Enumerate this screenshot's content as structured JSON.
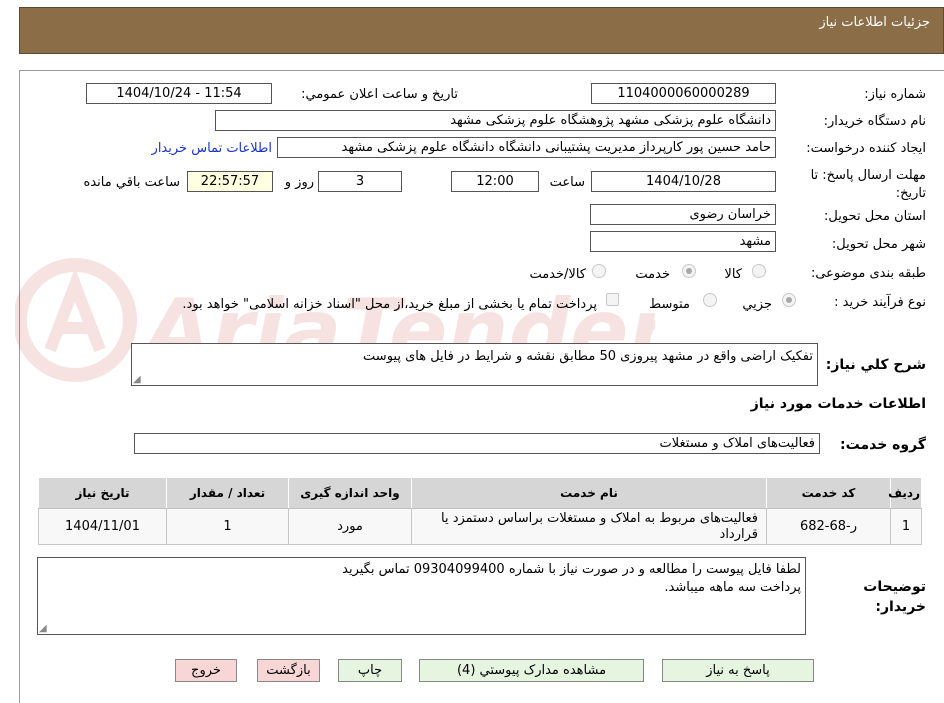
{
  "header": {
    "title": "جزئيات اطلاعات نياز"
  },
  "fields": {
    "need_number_label": "شماره نياز:",
    "need_number_value": "1104000060000289",
    "announce_label": "تاريخ و ساعت اعلان عمومي:",
    "announce_value": "1404/10/24 - 11:54",
    "buyer_org_label": "نام دستگاه خريدار:",
    "buyer_org_value": "دانشگاه علوم پزشکی مشهد   پژوهشگاه علوم پزشکی مشهد",
    "requester_label": "ايجاد کننده درخواست:",
    "requester_value": "حامد حسین پور کارپرداز مدیریت پشتیبانی دانشگاه دانشگاه علوم پزشکی مشهد",
    "contact_link": "اطلاعات تماس خريدار",
    "deadline_label": "مهلت ارسال پاسخ: تا تاريخ:",
    "deadline_date": "1404/10/28",
    "time_label": "ساعت",
    "deadline_time": "12:00",
    "days_value": "3",
    "days_label": "روز و",
    "remaining_time": "22:57:57",
    "remaining_label": "ساعت باقي مانده",
    "province_label": "استان محل تحويل:",
    "province_value": "خراسان رضوی",
    "city_label": "شهر محل تحويل:",
    "city_value": "مشهد"
  },
  "category": {
    "label": "طبقه بندی موضوعی:",
    "options": [
      "کالا",
      "خدمت",
      "کالا/خدمت"
    ],
    "selected": "خدمت"
  },
  "process": {
    "label": "نوع فرآيند خريد :",
    "options": [
      "جزيي",
      "متوسط"
    ],
    "selected": "جزيي",
    "note": "پرداخت تمام یا بخشی از مبلغ خرید،از محل \"اسناد خزانه اسلامی\" خواهد بود."
  },
  "description": {
    "label": "شرح کلي نياز:",
    "value": "تفکیک اراضی واقع در مشهد پیروزی 50 مطابق نقشه و شرایط در فایل های پیوست"
  },
  "services": {
    "section_title": "اطلاعات خدمات مورد نياز",
    "group_label": "گروه خدمت:",
    "group_value": "فعالیت‌های  املاک و مستغلات",
    "columns": [
      "رديف",
      "کد خدمت",
      "نام خدمت",
      "واحد اندازه گيری",
      "تعداد / مقدار",
      "تاريخ نياز"
    ],
    "rows": [
      [
        "1",
        "ر-68-682",
        "فعالیت‌های مربوط به املاک و مستغلات براساس دستمزد يا قرارداد",
        "مورد",
        "1",
        "1404/11/01"
      ]
    ]
  },
  "buyer_notes": {
    "label": "توضيحات خريدار:",
    "line1": "لطفا فایل پیوست را مطالعه و در صورت نیاز با شماره 09304099400 تماس بگیرید",
    "line2": "پرداخت سه ماهه میباشد."
  },
  "buttons": {
    "reply": "پاسخ به نياز",
    "attachments": "مشاهده مدارک پيوستي (4)",
    "print": "چاپ",
    "back": "بازگشت",
    "exit": "خروج"
  },
  "watermark": {
    "text": "AriaTender.neT"
  },
  "colors": {
    "header_bg": "#8b6e47",
    "link": "#1a33cc",
    "remaining_bg": "#fefee0"
  }
}
